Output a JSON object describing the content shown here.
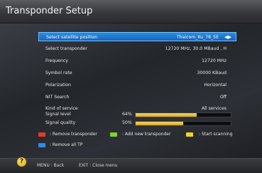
{
  "window": {
    "title": "Transponder Setup"
  },
  "menu": {
    "rows": [
      {
        "label": "Select satellite position",
        "value": "Thaicom_Ku_78_5E"
      },
      {
        "label": "Select transponder",
        "value": "12720 MHz, 30.0 MBaud , H"
      },
      {
        "label": "Frequency",
        "value": "12720 MHz"
      },
      {
        "label": "Symbol rate",
        "value": "30000 KBaud"
      },
      {
        "label": "Polarization",
        "value": "Horizontal"
      },
      {
        "label": "NIT Search",
        "value": "Off"
      },
      {
        "label": "Kind of service",
        "value": "All services"
      }
    ]
  },
  "signal": {
    "level": {
      "label": "Signal level",
      "percent_text": "64%",
      "value": 0.64
    },
    "quality": {
      "label": "Signal quality",
      "percent_text": "50%",
      "value": 0.5
    }
  },
  "legend": {
    "red": {
      "text": ": Remove transponder",
      "color": "#e23b2a"
    },
    "green": {
      "text": ": Add new transponder",
      "color": "#7fd12b"
    },
    "yellow": {
      "text": ": Start scanning",
      "color": "#f3d22a"
    },
    "blue": {
      "text": ": Remove all TP",
      "color": "#2e8fe6"
    }
  },
  "footer": {
    "menu_hint": "MENU : Back",
    "exit_hint": "EXIT : Close menu",
    "help_glyph": "?"
  },
  "accent": "#1f72c8"
}
